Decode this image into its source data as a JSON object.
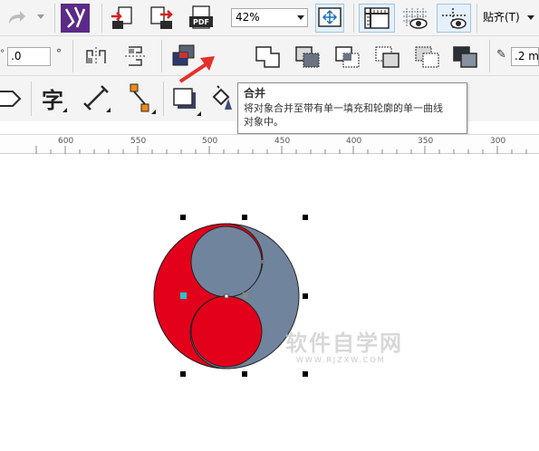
{
  "toolbar": {
    "zoom_value": "42%",
    "snap_label": "贴齐(T)",
    "angle_value": ".0",
    "angle_unit": "°",
    "outline_value": ".2 mm"
  },
  "tooltip": {
    "title": "合并",
    "description_line1": "将对象合并至带有单一填充和轮廓的单一曲线",
    "description_line2": "对象中。"
  },
  "ruler": {
    "labels": [
      "600",
      "550",
      "500",
      "450",
      "400",
      "350",
      "300"
    ]
  },
  "watermark": {
    "main": "软件自学网",
    "sub": "WWW.RJZXW.COM"
  },
  "colors": {
    "red": "#e3001b",
    "slate": "#71849d",
    "highlight": "#cde5f7",
    "arrow": "#e5302a"
  }
}
